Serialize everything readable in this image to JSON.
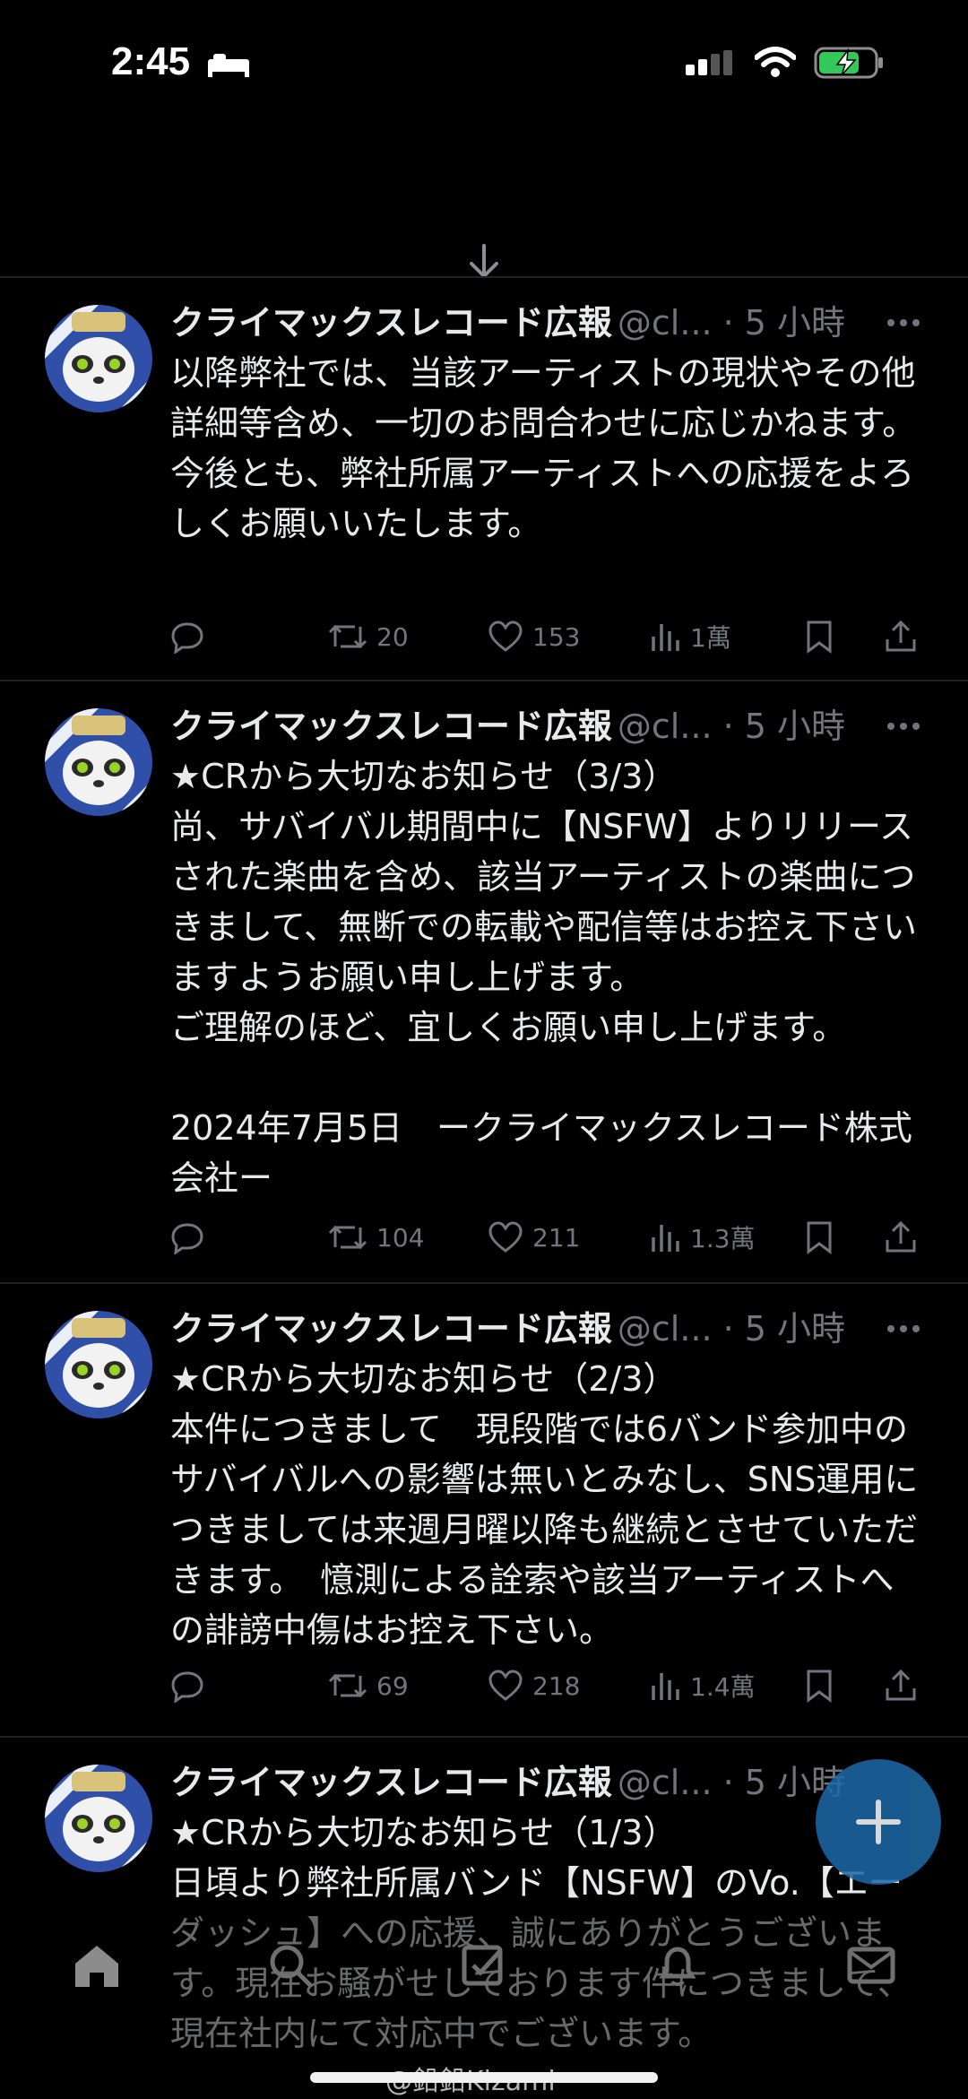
{
  "status_bar": {
    "time": "2:45"
  },
  "tweets": [
    {
      "name": "クライマックスレコード広報",
      "handle": "@cl... · 5 小時",
      "text": "以降弊社では、当該アーティストの現状やその他詳細等含め、一切のお問合わせに応じかねます。\n今後とも、弊社所属アーティストへの応援をよろしくお願いいたします。",
      "retweets": "20",
      "likes": "153",
      "views": "1萬"
    },
    {
      "name": "クライマックスレコード広報",
      "handle": "@cl... · 5 小時",
      "text": "★CRから大切なお知らせ（3/3）\n尚、サバイバル期間中に【NSFW】よりリリースされた楽曲を含め、該当アーティストの楽曲につきまして、無断での転載や配信等はお控え下さいますようお願い申し上げます。\nご理解のほど、宜しくお願い申し上げます。\n\n2024年7月5日　ークライマックスレコード株式会社ー",
      "retweets": "104",
      "likes": "211",
      "views": "1.3萬"
    },
    {
      "name": "クライマックスレコード広報",
      "handle": "@cl... · 5 小時",
      "text": "★CRから大切なお知らせ（2/3）\n本件につきまして　現段階では6バンド参加中のサバイバルへの影響は無いとみなし、SNS運用につきましては来週月曜以降も継続とさせていただきます。　憶測による詮索や該当アーティストへの誹謗中傷はお控え下さい。",
      "retweets": "69",
      "likes": "218",
      "views": "1.4萬"
    },
    {
      "name": "クライマックスレコード広報",
      "handle": "@cl... · 5 小時",
      "text": "★CRから大切なお知らせ（1/3）\n日頃より弊社所属バンド【NSFW】のVo.【エーダッシュ】への応援、誠にありがとうございます。現在お騒がせしております件につきまして、現在社内にて対応中でございます。"
    }
  ],
  "watermark": "@鉛鉛Kizami",
  "colors": {
    "background": "#000000",
    "text": "#e7e9ea",
    "muted": "#71767b",
    "fab": "#1d6aa8"
  },
  "icons": [
    "reply-icon",
    "retweet-icon",
    "like-icon",
    "views-icon",
    "bookmark-icon",
    "share-icon",
    "compose-icon",
    "home-icon",
    "search-icon",
    "communities-icon",
    "notifications-icon",
    "messages-icon"
  ]
}
